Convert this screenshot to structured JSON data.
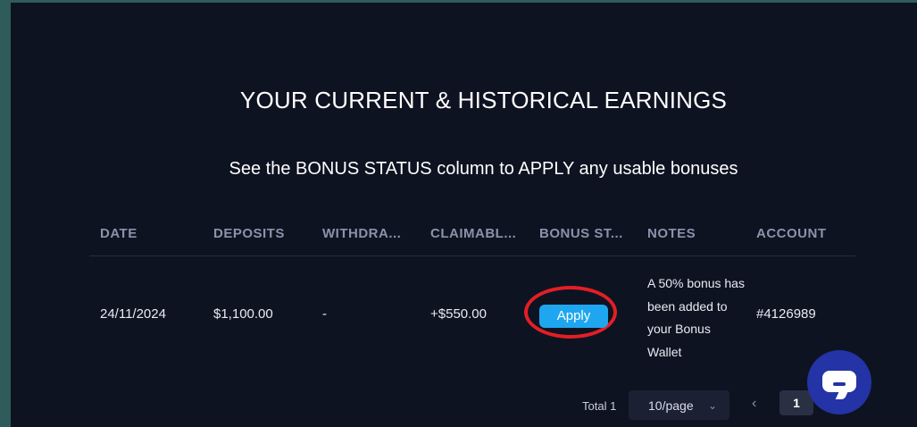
{
  "header": {
    "title": "YOUR CURRENT & HISTORICAL EARNINGS",
    "subtitle": "See the BONUS STATUS column to APPLY any usable bonuses"
  },
  "table": {
    "columns": [
      "DATE",
      "DEPOSITS",
      "WITHDRA...",
      "CLAIMABL...",
      "BONUS ST...",
      "NOTES",
      "ACCOUNT"
    ],
    "rows": [
      {
        "date": "24/11/2024",
        "deposits": "$1,100.00",
        "withdrawals": "-",
        "claimable": "+$550.00",
        "bonus_status_button": "Apply",
        "notes": "A 50% bonus has been added to your Bonus Wallet",
        "account": "#4126989"
      }
    ]
  },
  "pagination": {
    "total": "Total 1",
    "page_size": "10/page",
    "current_page": "1"
  },
  "icons": {
    "chat": "chat-bubble-icon",
    "prev": "chevron-left-icon",
    "dropdown": "chevron-down-icon"
  },
  "colors": {
    "background": "#0e1321",
    "accent_button": "#1ea7f0",
    "highlight_ring": "#e21f25",
    "chat_button": "#2433a6"
  }
}
